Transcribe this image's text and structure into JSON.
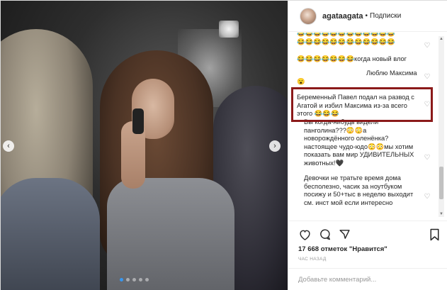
{
  "post": {
    "username": "agataagata",
    "separator": "•",
    "follow_label": "Подписки"
  },
  "comments": [
    {
      "text": "😂😂😂😂😂😂😂😂😂😂😂😂"
    },
    {
      "text": "😂😂😂😂😂😂😂😂😂😂😂😂"
    },
    {
      "text": "😂😂😂😂😂😂😂когда новый влог"
    },
    {
      "text": "Люблю Максима"
    },
    {
      "text": "😮"
    },
    {
      "text": "Беременный Павел подал на развод с Агатой и избил Максима из-за всего этого 😂😂😂"
    },
    {
      "text": "Вы когда-нибудь видели панголина???😳😳а новорождённого оленёнка? настоящее чудо-юдо😳😳мы хотим показать вам мир УДИВИТЕЛЬНЫХ животных!🖤"
    },
    {
      "text": "Девочки не тратьте время дома бесполезно, часик за ноутбуком посижу и 50+тыс в неделю выходит см. инст мой если интересно"
    }
  ],
  "icons": {
    "like": "heart-icon",
    "comment": "comment-icon",
    "share": "share-icon",
    "save": "bookmark-icon",
    "comment_like": "heart-icon"
  },
  "stats": {
    "likes_text": "17 668 отметок \"Нравится\"",
    "time_text": "ЧАС НАЗАД"
  },
  "add_comment": {
    "placeholder": "Добавьте комментарий..."
  },
  "carousel": {
    "total": 5,
    "current": 1
  },
  "colors": {
    "highlight": "#8b1a1a",
    "active_dot": "#3897f0"
  }
}
